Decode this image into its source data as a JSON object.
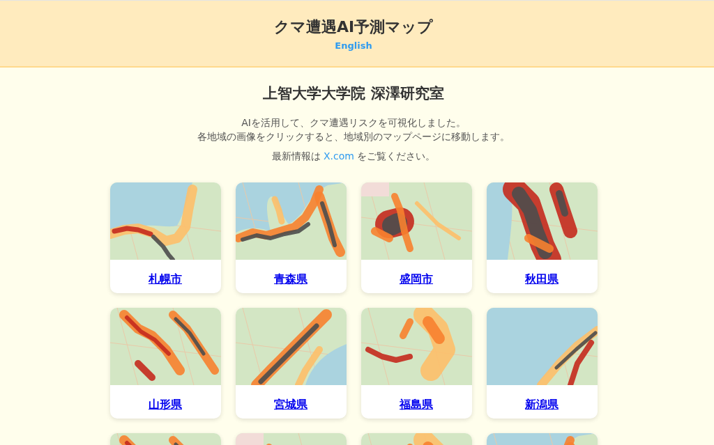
{
  "header": {
    "title": "クマ遭遇AI予測マップ",
    "language_link": "English"
  },
  "lab": {
    "title": "上智大学大学院 深澤研究室",
    "intro_lines": [
      "AIを活用して、クマ遭遇リスクを可視化しました。",
      "各地域の画像をクリックすると、地域別のマップページに移動します。"
    ],
    "news_note": {
      "before": "最新情報は ",
      "link": "X.com",
      "after": " をご覧ください。"
    }
  },
  "regions": [
    {
      "kind": "map",
      "name": "札幌市"
    },
    {
      "kind": "map",
      "name": "青森県"
    },
    {
      "kind": "map",
      "name": "盛岡市"
    },
    {
      "kind": "map",
      "name": "秋田県"
    },
    {
      "kind": "map",
      "name": "山形県"
    },
    {
      "kind": "map",
      "name": "宮城県"
    },
    {
      "kind": "map",
      "name": "福島県"
    },
    {
      "kind": "map",
      "name": "新潟県"
    },
    {
      "kind": "map"
    },
    {
      "kind": "map"
    },
    {
      "kind": "map"
    },
    {
      "kind": "map"
    }
  ]
}
